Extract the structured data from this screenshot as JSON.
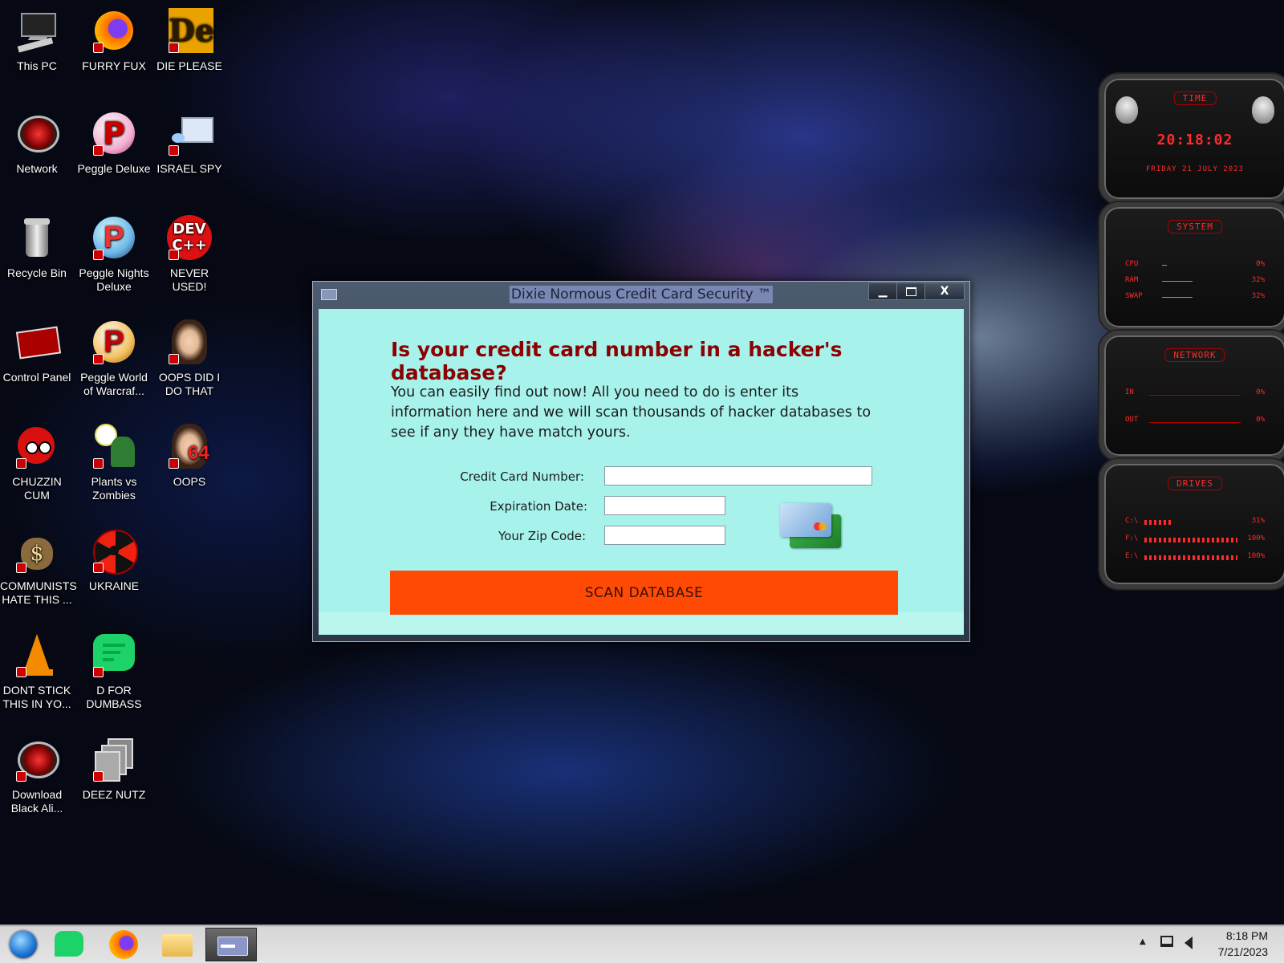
{
  "desktop": {
    "icons": [
      {
        "label": "This PC"
      },
      {
        "label": "FURRY FUX"
      },
      {
        "label": "DIE PLEASE"
      },
      {
        "label": "Network"
      },
      {
        "label": "Peggle Deluxe"
      },
      {
        "label": "ISRAEL SPY"
      },
      {
        "label": "Recycle Bin"
      },
      {
        "label": "Peggle Nights Deluxe"
      },
      {
        "label": "NEVER USED!"
      },
      {
        "label": "Control Panel"
      },
      {
        "label": "Peggle World of Warcraf..."
      },
      {
        "label": "OOPS DID I DO THAT"
      },
      {
        "label": "CHUZZIN CUM"
      },
      {
        "label": "Plants vs Zombies"
      },
      {
        "label": "OOPS"
      },
      {
        "label": "COMMUNISTS HATE THIS ..."
      },
      {
        "label": "UKRAINE"
      },
      {
        "label": "DONT STICK THIS IN YO..."
      },
      {
        "label": "D FOR DUMBASS"
      },
      {
        "label": "Download Black Ali..."
      },
      {
        "label": "DEEZ NUTZ"
      }
    ],
    "icon_glyphs": {
      "die_please": "De",
      "never_used_line1": "DEV",
      "never_used_line2": "C++",
      "oops_number": "64"
    }
  },
  "widget": {
    "time": {
      "title": "TIME",
      "clock": "20:18:02",
      "date": "FRIDAY 21 JULY 2023"
    },
    "system": {
      "title": "SYSTEM",
      "rows": [
        {
          "label": "CPU",
          "value": "0%",
          "level": 0.05
        },
        {
          "label": "RAM",
          "value": "32%",
          "level": 0.32
        },
        {
          "label": "SWAP",
          "value": "32%",
          "level": 0.32
        }
      ]
    },
    "network": {
      "title": "NETWORK",
      "rows": [
        {
          "label": "IN",
          "value": "0%"
        },
        {
          "label": "OUT",
          "value": "0%"
        }
      ]
    },
    "drives": {
      "title": "DRIVES",
      "rows": [
        {
          "label": "C:\\",
          "value": "31%"
        },
        {
          "label": "F:\\",
          "value": "100%"
        },
        {
          "label": "E:\\",
          "value": "100%"
        }
      ]
    }
  },
  "dialog": {
    "title": "Dixie Normous Credit Card Security ™",
    "minimize": "▁",
    "close": "X",
    "headline": "Is your credit card number in a hacker's database?",
    "intro": "You can easily find out now! All you need to do is enter its information here and we will scan thousands of hacker databases to see if any they have match yours.",
    "fields": {
      "card_number_label": "Credit Card Number:",
      "card_number_value": "",
      "expiration_label": "Expiration Date:",
      "expiration_value": "",
      "zip_label": "Your Zip Code:",
      "zip_value": ""
    },
    "scan_button": "SCAN DATABASE"
  },
  "taskbar": {
    "clock_time": "8:18 PM",
    "clock_date": "7/21/2023",
    "tray_arrow": "▲",
    "icons": [
      "start-orb",
      "d-for-dumbass",
      "firefox",
      "file-explorer",
      "credit-card-app"
    ]
  },
  "colors": {
    "dialog_bg": "#a7f3ec",
    "headline": "#8b0000",
    "scan_button": "#ff4a05",
    "widget_red": "#ff2a2a"
  }
}
